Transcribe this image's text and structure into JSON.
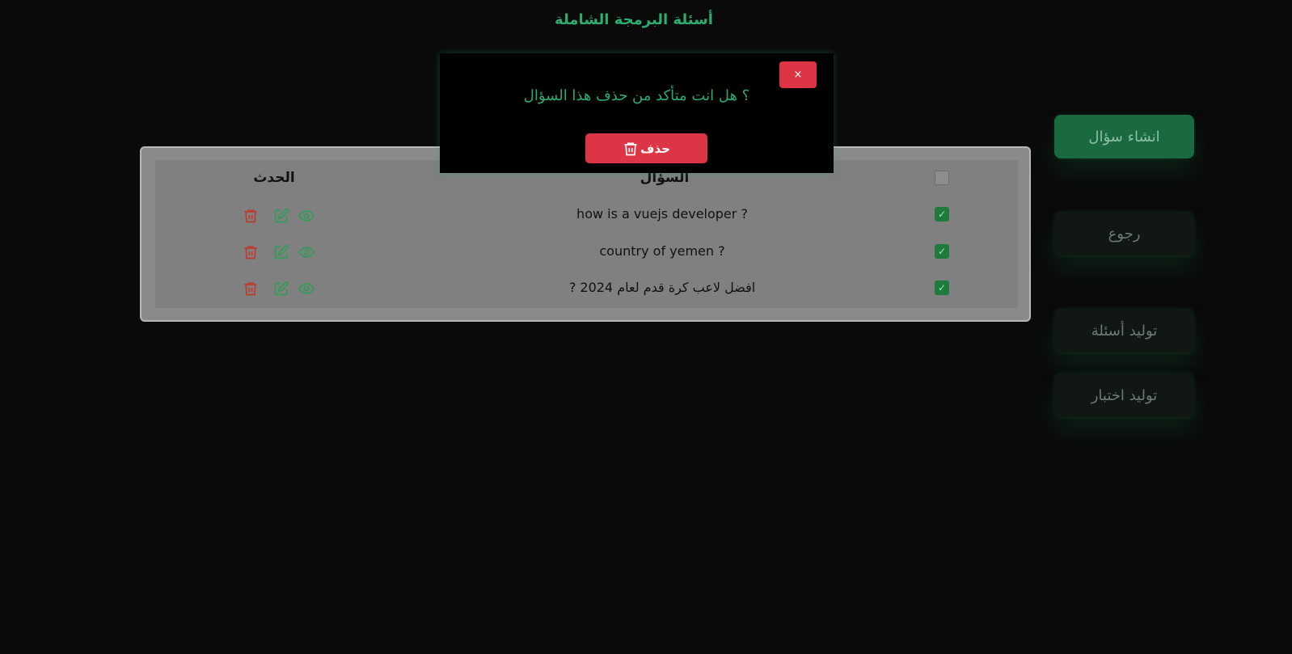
{
  "header": {
    "title": "أسئلة البرمجة الشاملة"
  },
  "sidebar": {
    "items": [
      {
        "label": "انشاء سؤال",
        "active": true
      },
      {
        "label": "رجوع"
      },
      {
        "label": "توليد أسئلة"
      },
      {
        "label": "توليد اختبار"
      }
    ]
  },
  "table": {
    "headers": {
      "question": "السؤال",
      "action": "الحدث"
    },
    "rows": [
      {
        "question": "how is a vuejs developer ?",
        "checked": true
      },
      {
        "question": "country of yemen ?",
        "checked": true
      },
      {
        "question": "? افضل لاعب كرة قدم لعام 2024",
        "checked": true
      }
    ]
  },
  "modal": {
    "message": "؟ هل انت متأكد من حذف هذا السؤال",
    "close_label": "×",
    "delete_label": "حذف"
  },
  "colors": {
    "accent": "#2eab6e",
    "danger": "#dc3545",
    "edit_icon": "#2e9e55",
    "view_icon": "#2e9e55",
    "delete_icon": "#c0392b"
  },
  "icons": [
    "trash-icon",
    "edit-icon",
    "eye-icon",
    "check-icon",
    "close-icon"
  ]
}
